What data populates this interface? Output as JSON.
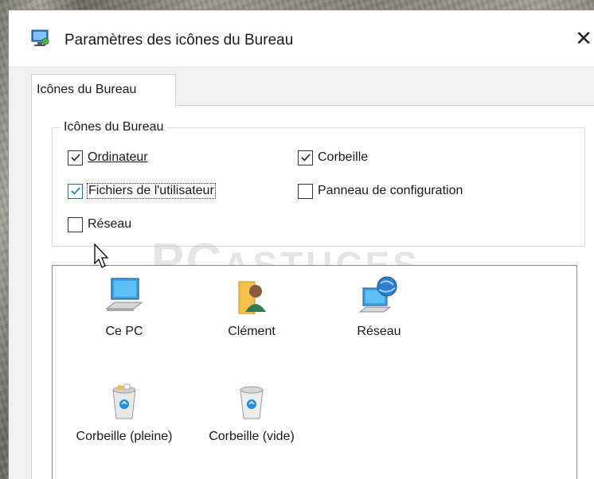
{
  "window": {
    "title": "Paramètres des icônes du Bureau",
    "close_glyph": "✕"
  },
  "tabs": [
    {
      "label": "Icônes du Bureau",
      "selected": true
    }
  ],
  "group": {
    "legend": "Icônes du Bureau",
    "checkboxes": [
      {
        "label": "Ordinateur",
        "checked": true
      },
      {
        "label": "Corbeille",
        "checked": true
      },
      {
        "label": "Fichiers de l'utilisateur",
        "checked": true,
        "focused": true
      },
      {
        "label": "Panneau de configuration",
        "checked": false
      },
      {
        "label": "Réseau",
        "checked": false
      }
    ]
  },
  "icons": [
    {
      "label": "Ce PC",
      "icon": "computer-icon"
    },
    {
      "label": "Clément",
      "icon": "user-folder-icon"
    },
    {
      "label": "Réseau",
      "icon": "network-icon"
    },
    {
      "label": "Corbeille (pleine)",
      "icon": "recycle-bin-full-icon"
    },
    {
      "label": "Corbeille (vide)",
      "icon": "recycle-bin-empty-icon"
    }
  ],
  "watermark": {
    "main": "PC",
    "secondary": "ASTUCES"
  },
  "colors": {
    "accent": "#0078d7",
    "checkbox_border": "#333333",
    "panel_border": "#d0d0d0"
  }
}
